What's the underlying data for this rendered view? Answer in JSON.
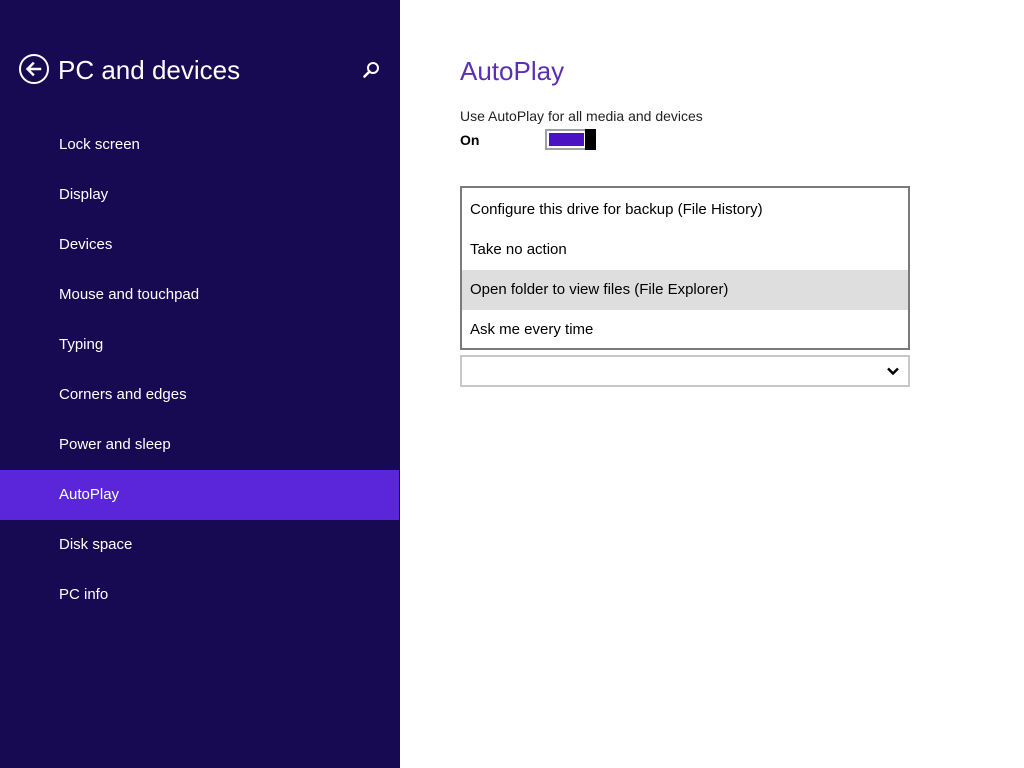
{
  "sidebar": {
    "title": "PC and devices",
    "back_icon": "back-arrow-icon",
    "search_icon": "search-icon",
    "background_color": "#180a52",
    "selected_color": "#5b26d9",
    "items": [
      {
        "label": "Lock screen",
        "selected": false
      },
      {
        "label": "Display",
        "selected": false
      },
      {
        "label": "Devices",
        "selected": false
      },
      {
        "label": "Mouse and touchpad",
        "selected": false
      },
      {
        "label": "Typing",
        "selected": false
      },
      {
        "label": "Corners and edges",
        "selected": false
      },
      {
        "label": "Power and sleep",
        "selected": false
      },
      {
        "label": "AutoPlay",
        "selected": true
      },
      {
        "label": "Disk space",
        "selected": false
      },
      {
        "label": "PC info",
        "selected": false
      }
    ]
  },
  "main": {
    "title": "AutoPlay",
    "title_color": "#5b2fb2",
    "autoplay_setting": {
      "label": "Use AutoPlay for all media and devices",
      "state_label": "On",
      "enabled": true,
      "accent_color": "#4a12c0"
    },
    "dropdown": {
      "expanded": true,
      "highlighted_index": 2,
      "selected_value": "",
      "chevron_icon": "chevron-down-icon",
      "options": [
        {
          "label": "Configure this drive for backup (File History)"
        },
        {
          "label": "Take no action"
        },
        {
          "label": "Open folder to view files (File Explorer)"
        },
        {
          "label": "Ask me every time"
        }
      ]
    }
  }
}
